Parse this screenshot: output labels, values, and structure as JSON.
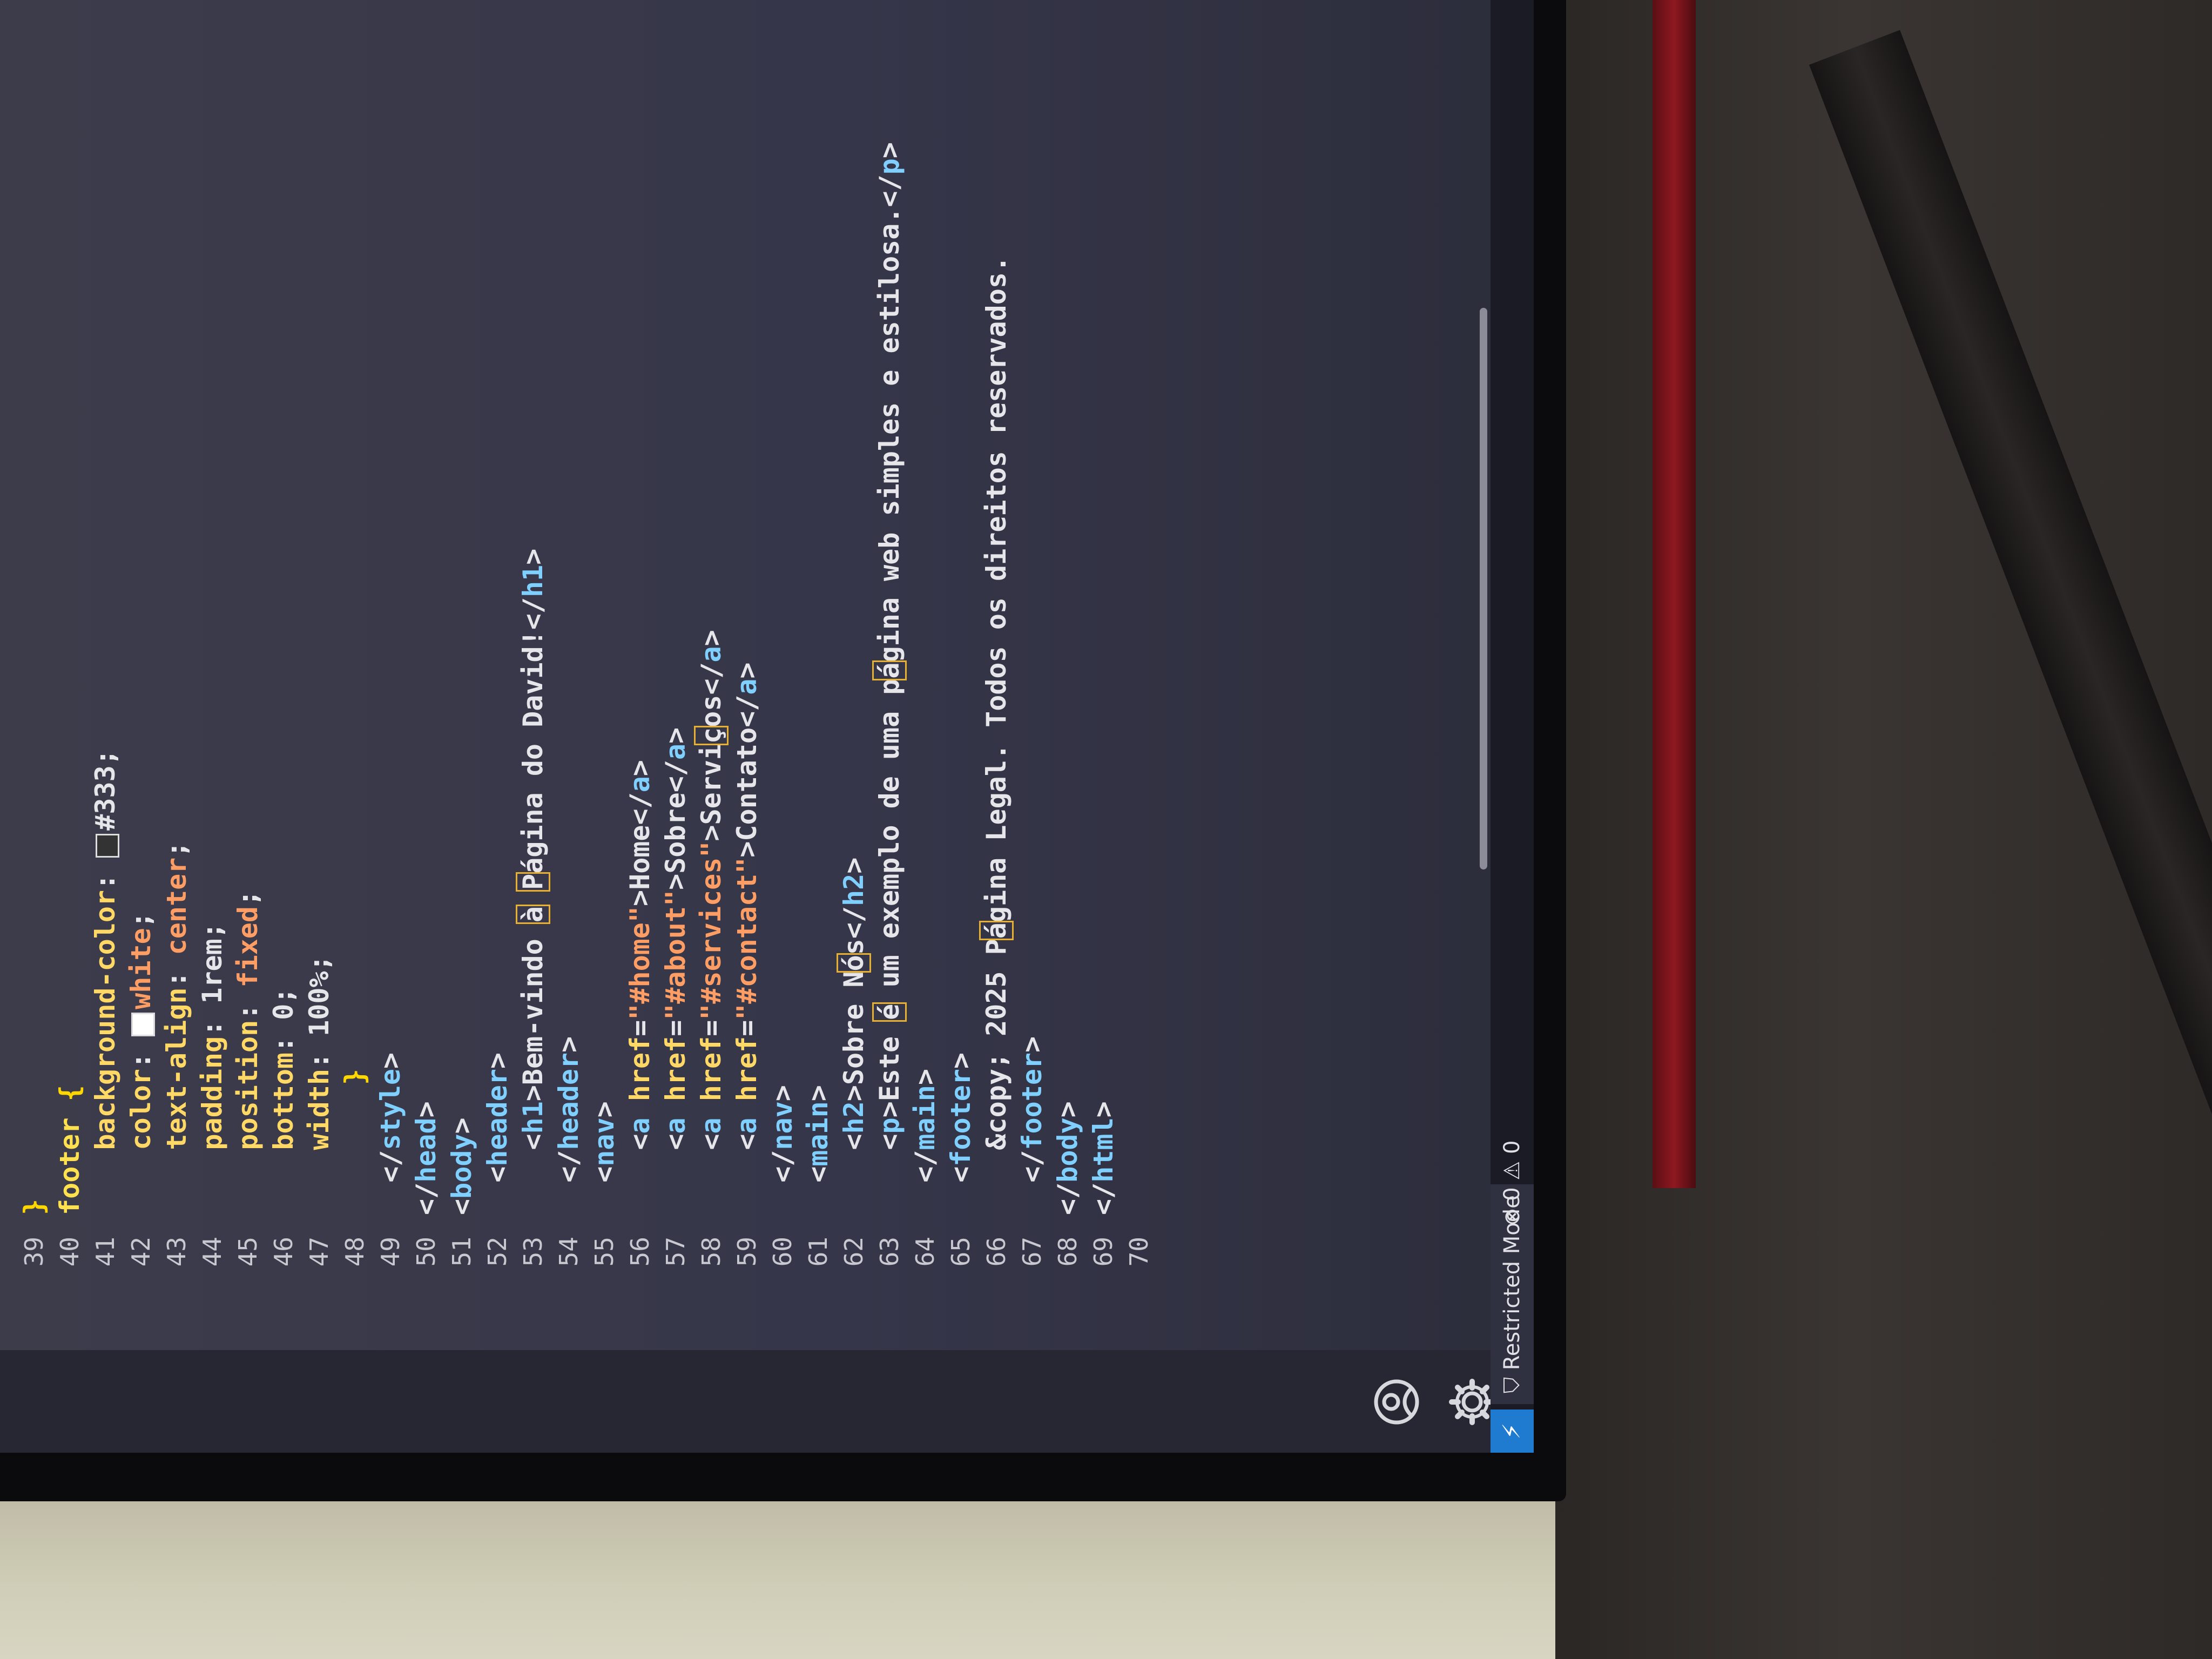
{
  "editor": {
    "lines": [
      {
        "n": "39",
        "html": "<span class='br'>}</span>"
      },
      {
        "n": "40",
        "html": "<span class='sel'>footer</span> <span class='br'>{</span>"
      },
      {
        "n": "41",
        "html": "    <span class='at'>background-color</span>: <span class='swatch' style='background:#333'></span>#333;"
      },
      {
        "n": "42",
        "html": "    <span class='at'>color</span>: <span class='swatch' style='background:#fff'></span><span class='val-o'>white</span>;"
      },
      {
        "n": "43",
        "html": "    <span class='at'>text-align</span>: <span class='val-o'>center</span>;"
      },
      {
        "n": "44",
        "html": "    <span class='at'>padding</span>: 1rem;"
      },
      {
        "n": "45",
        "html": "    <span class='at'>position</span>: <span class='val-o'>fixed</span>;"
      },
      {
        "n": "46",
        "html": "    <span class='at'>bottom</span>: 0;"
      },
      {
        "n": "47",
        "html": "    <span class='at'>width</span>: 100%;"
      },
      {
        "n": "48",
        "html": "        <span class='br'>}</span>"
      },
      {
        "n": "49",
        "html": "  &lt;/<span class='t'>style</span>&gt;"
      },
      {
        "n": "50",
        "html": "&lt;/<span class='t'>head</span>&gt;"
      },
      {
        "n": "51",
        "html": "&lt;<span class='t'>body</span>&gt;"
      },
      {
        "n": "52",
        "html": "  &lt;<span class='t'>header</span>&gt;"
      },
      {
        "n": "53",
        "html": "    &lt;<span class='t'>h1</span>&gt;Bem-vindo <span class='hl'>à</span> <span class='hl'>P</span>ágina do David!&lt;/<span class='t'>h1</span>&gt;"
      },
      {
        "n": "54",
        "html": "  &lt;/<span class='t'>header</span>&gt;"
      },
      {
        "n": "55",
        "html": "  &lt;<span class='t'>nav</span>&gt;"
      },
      {
        "n": "56",
        "html": "    &lt;<span class='t'>a</span> <span class='at'>href</span>=<span class='s'>\"#home\"</span>&gt;Home&lt;/<span class='t'>a</span>&gt;"
      },
      {
        "n": "57",
        "html": "    &lt;<span class='t'>a</span> <span class='at'>href</span>=<span class='s'>\"#about\"</span>&gt;Sobre&lt;/<span class='t'>a</span>&gt;"
      },
      {
        "n": "58",
        "html": "    &lt;<span class='t'>a</span> <span class='at'>href</span>=<span class='s'>\"#services\"</span>&gt;Servi<span class='hl'>ç</span>os&lt;/<span class='t'>a</span>&gt;"
      },
      {
        "n": "59",
        "html": "    &lt;<span class='t'>a</span> <span class='at'>href</span>=<span class='s'>\"#contact\"</span>&gt;Contato&lt;/<span class='t'>a</span>&gt;"
      },
      {
        "n": "60",
        "html": "  &lt;/<span class='t'>nav</span>&gt;"
      },
      {
        "n": "61",
        "html": "  &lt;<span class='t'>main</span>&gt;"
      },
      {
        "n": "62",
        "html": "    &lt;<span class='t'>h2</span>&gt;Sobre N<span class='hl'>ó</span>s&lt;/<span class='t'>h2</span>&gt;"
      },
      {
        "n": "63",
        "html": "    &lt;<span class='t'>p</span>&gt;Este <span class='hl'>é</span> um exemplo de uma p<span class='hl'>á</span>gina web simples e estilosa.&lt;/<span class='t'>p</span>&gt;"
      },
      {
        "n": "64",
        "html": "  &lt;/<span class='t'>main</span>&gt;"
      },
      {
        "n": "65",
        "html": "  &lt;<span class='t'>footer</span>&gt;"
      },
      {
        "n": "66",
        "html": "    &amp;copy; 2025 P<span class='hl'>á</span>gina Legal. Todos os direitos reservados."
      },
      {
        "n": "67",
        "html": "  &lt;/<span class='t'>footer</span>&gt;"
      },
      {
        "n": "68",
        "html": "&lt;/<span class='t'>body</span>&gt;"
      },
      {
        "n": "69",
        "html": "&lt;/<span class='t'>html</span>&gt;"
      },
      {
        "n": "70",
        "html": ""
      }
    ]
  },
  "statusbar": {
    "remote_icon": "remote-indicator-icon",
    "restricted_mode": "Restricted Mode",
    "errors": "0",
    "warnings": "0"
  },
  "activity_bar": {
    "account_icon": "account-icon",
    "settings_icon": "gear-icon"
  }
}
